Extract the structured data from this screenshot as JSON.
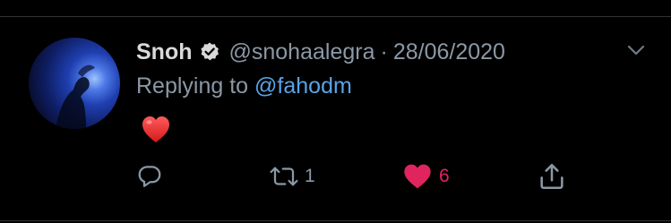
{
  "tweet": {
    "display_name": "Snoh",
    "handle": "@snohaalegra",
    "separator": "·",
    "date": "28/06/2020",
    "replying_prefix": "Replying to",
    "replying_to": "@fahodm",
    "body_emoji": "red-heart-emoji",
    "verified_icon": "verified-badge-icon"
  },
  "actions": {
    "reply_count": "",
    "retweet_count": "1",
    "like_count": "6",
    "liked": true
  },
  "colors": {
    "background": "#000000",
    "text_primary": "#d9d9d9",
    "text_secondary": "#8b98a5",
    "link": "#5aa3e6",
    "like": "#e0245e",
    "divider": "#2f3336"
  }
}
